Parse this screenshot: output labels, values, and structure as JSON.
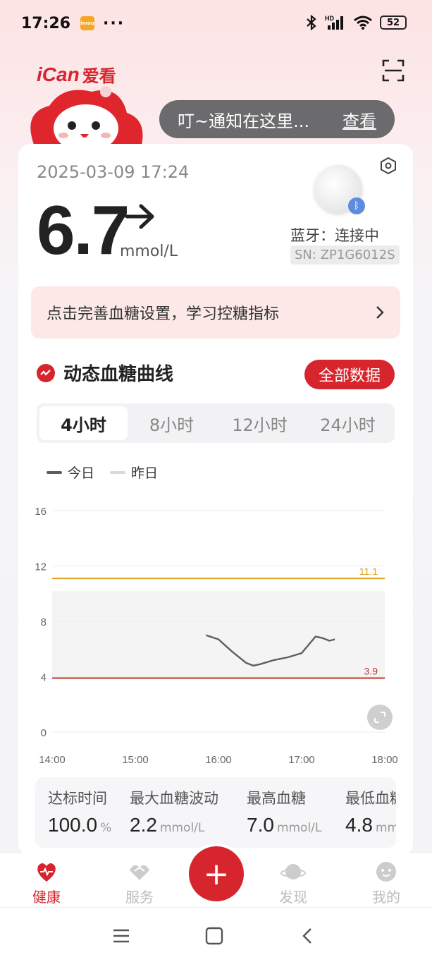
{
  "status_bar": {
    "time": "17:26",
    "app_badge": "imou",
    "more": "···",
    "battery": "52"
  },
  "header": {
    "brand": "iCan",
    "brand_cn": "爱看"
  },
  "notice": {
    "message": "叮~通知在这里...",
    "action": "查看"
  },
  "reading": {
    "timestamp": "2025-03-09 17:24",
    "value": "6.7",
    "unit": "mmol/L",
    "trend": "steady-right-arrow",
    "bluetooth_status": "蓝牙：连接中",
    "serial": "SN: ZP1G6012S"
  },
  "setup_banner": {
    "label": "点击完善血糖设置，学习控糖指标"
  },
  "curve_section": {
    "title": "动态血糖曲线",
    "all_data_button": "全部数据",
    "tabs": [
      "4小时",
      "8小时",
      "12小时",
      "24小时"
    ],
    "active_tab": "4小时",
    "legend": [
      {
        "label": "今日",
        "color": "#5a5f66"
      },
      {
        "label": "昨日",
        "color": "#d9d9d9"
      }
    ]
  },
  "chart_data": {
    "type": "line",
    "x_ticks": [
      "14:00",
      "15:00",
      "16:00",
      "17:00",
      "18:00"
    ],
    "y_ticks": [
      "16",
      "12",
      "8",
      "4",
      "0"
    ],
    "ylim": [
      0,
      16
    ],
    "xlim": [
      "14:00",
      "18:00"
    ],
    "upper_limit": {
      "value": 11.1,
      "label": "11.1",
      "color": "#e0a21f"
    },
    "lower_limit": {
      "value": 3.9,
      "label": "3.9",
      "color": "#c0392b"
    },
    "series": [
      {
        "color": "#5a5f66",
        "x": [
          "15:51",
          "16:00",
          "16:10",
          "16:20",
          "16:25",
          "16:30",
          "16:40",
          "16:50",
          "17:00",
          "17:05",
          "17:10",
          "17:15",
          "17:20",
          "17:24"
        ],
        "values": [
          7.0,
          6.7,
          5.8,
          5.0,
          4.8,
          4.9,
          5.2,
          5.4,
          5.7,
          6.3,
          6.9,
          6.8,
          6.6,
          6.7
        ]
      }
    ]
  },
  "stats": [
    {
      "label": "达标时间",
      "value": "100.0",
      "unit": "%"
    },
    {
      "label": "最大血糖波动",
      "value": "2.2",
      "unit": "mmol/L"
    },
    {
      "label": "最高血糖",
      "value": "7.0",
      "unit": "mmol/L"
    },
    {
      "label": "最低血糖",
      "value": "4.8",
      "unit": "mmol/L"
    }
  ],
  "bottom_nav": {
    "items": [
      {
        "label": "健康",
        "icon": "heart-pulse-icon",
        "active": true
      },
      {
        "label": "服务",
        "icon": "handshake-icon",
        "active": false
      },
      {
        "label": "发现",
        "icon": "planet-icon",
        "active": false
      },
      {
        "label": "我的",
        "icon": "face-icon",
        "active": false
      }
    ],
    "fab": "+"
  },
  "colors": {
    "accent": "#d6252c",
    "card": "#ffffff",
    "banner": "#fde8e8"
  }
}
